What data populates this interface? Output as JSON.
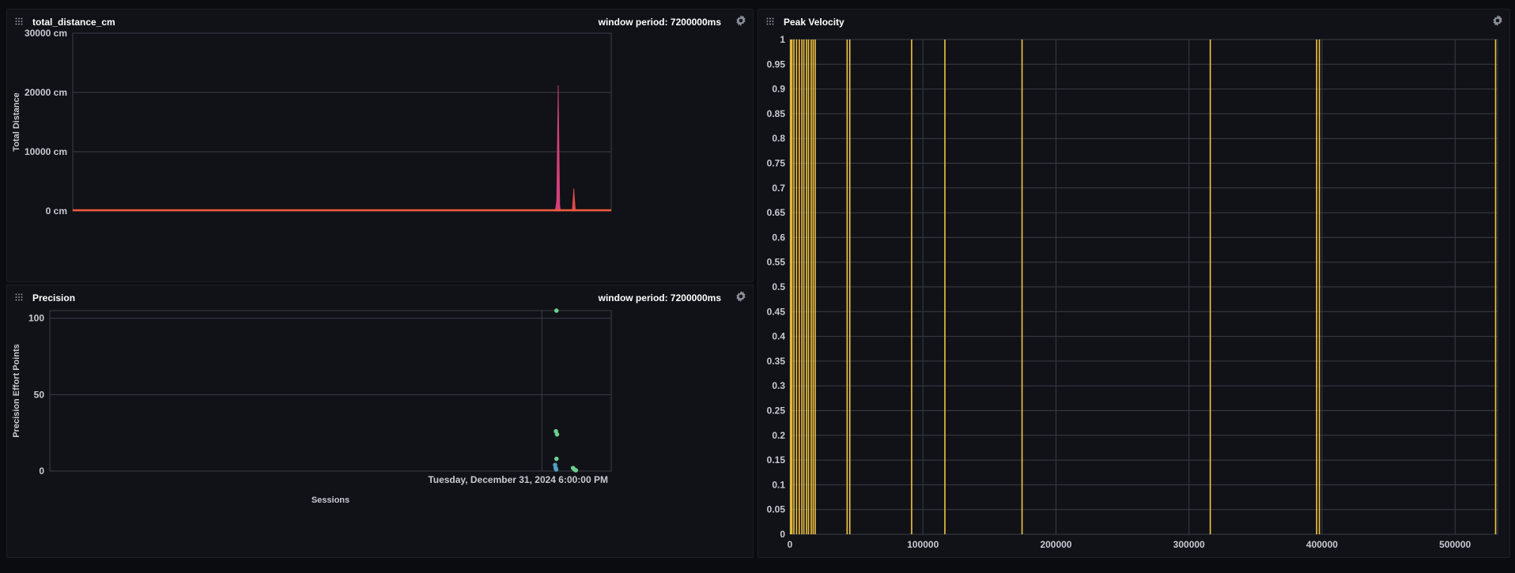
{
  "panels": {
    "total_distance": {
      "title": "total_distance_cm",
      "window_label": "window period: 7200000ms"
    },
    "precision": {
      "title": "Precision",
      "window_label": "window period: 7200000ms"
    },
    "peak_velocity": {
      "title": "Peak Velocity"
    }
  },
  "colors": {
    "panel_bg": "#111218",
    "grid": "#3a3d46",
    "distance_line": "#ef5a3c",
    "distance_spike": "#d6407a",
    "distance_spike_2": "#e04a4a",
    "precision_point_a": "#6ccf8e",
    "precision_point_b": "#4fa0c2",
    "velocity_line": "#f4c542"
  },
  "icons": [
    "drag-handle-icon",
    "gear-icon"
  ],
  "chart_data": [
    {
      "id": "total_distance",
      "type": "area",
      "title": "total_distance_cm",
      "xlabel": "",
      "ylabel": "Total Distance",
      "ylim": [
        0,
        30000
      ],
      "y_ticks": [
        {
          "value": 0,
          "label": "0 cm"
        },
        {
          "value": 10000,
          "label": "10000 cm"
        },
        {
          "value": 20000,
          "label": "20000 cm"
        },
        {
          "value": 30000,
          "label": "30000 cm"
        }
      ],
      "xlim": [
        0,
        1
      ],
      "series": [
        {
          "name": "total_distance_cm",
          "baseline": 0,
          "spikes": [
            {
              "x": 0.899,
              "y": 1800
            },
            {
              "x": 0.9005,
              "y": 3400
            },
            {
              "x": 0.9015,
              "y": 21200
            },
            {
              "x": 0.903,
              "y": 1600
            },
            {
              "x": 0.9305,
              "y": 3800
            }
          ]
        }
      ],
      "grid": true
    },
    {
      "id": "precision",
      "type": "scatter",
      "title": "Precision",
      "xlabel": "Sessions",
      "ylabel": "Precision Effort Points",
      "ylim": [
        0,
        105
      ],
      "y_ticks": [
        {
          "value": 0,
          "label": "0"
        },
        {
          "value": 50,
          "label": "50"
        },
        {
          "value": 100,
          "label": "100"
        }
      ],
      "xlim": [
        0,
        1
      ],
      "marker": {
        "x": 0.8765,
        "label": "Tuesday, December 31, 2024  6:00:00 PM"
      },
      "points": [
        {
          "x": 0.9025,
          "y": 105,
          "s": "a"
        },
        {
          "x": 0.9015,
          "y": 26,
          "s": "a"
        },
        {
          "x": 0.9035,
          "y": 24,
          "s": "a"
        },
        {
          "x": 0.9025,
          "y": 8,
          "s": "a"
        },
        {
          "x": 0.9,
          "y": 4,
          "s": "b"
        },
        {
          "x": 0.901,
          "y": 2,
          "s": "b"
        },
        {
          "x": 0.902,
          "y": 1,
          "s": "b"
        },
        {
          "x": 0.932,
          "y": 2,
          "s": "a"
        },
        {
          "x": 0.9345,
          "y": 1,
          "s": "a"
        },
        {
          "x": 0.937,
          "y": 0.5,
          "s": "a"
        }
      ],
      "grid": true
    },
    {
      "id": "peak_velocity",
      "type": "line",
      "title": "Peak Velocity",
      "xlabel": "",
      "ylabel": "",
      "xlim": [
        0,
        532000
      ],
      "ylim": [
        0,
        1
      ],
      "x_ticks": [
        0,
        100000,
        200000,
        300000,
        400000,
        500000
      ],
      "y_ticks": [
        0,
        0.05,
        0.1,
        0.15,
        0.2,
        0.25,
        0.3,
        0.35,
        0.4,
        0.45,
        0.5,
        0.55,
        0.6,
        0.65,
        0.7,
        0.75,
        0.8,
        0.85,
        0.9,
        0.95,
        1
      ],
      "vertical_lines_x": [
        500,
        1500,
        3000,
        5000,
        7000,
        9000,
        10500,
        12500,
        14000,
        16000,
        17500,
        19000,
        43000,
        45000,
        91500,
        116500,
        174500,
        316000,
        396000,
        398000,
        530500
      ],
      "grid": true
    }
  ]
}
